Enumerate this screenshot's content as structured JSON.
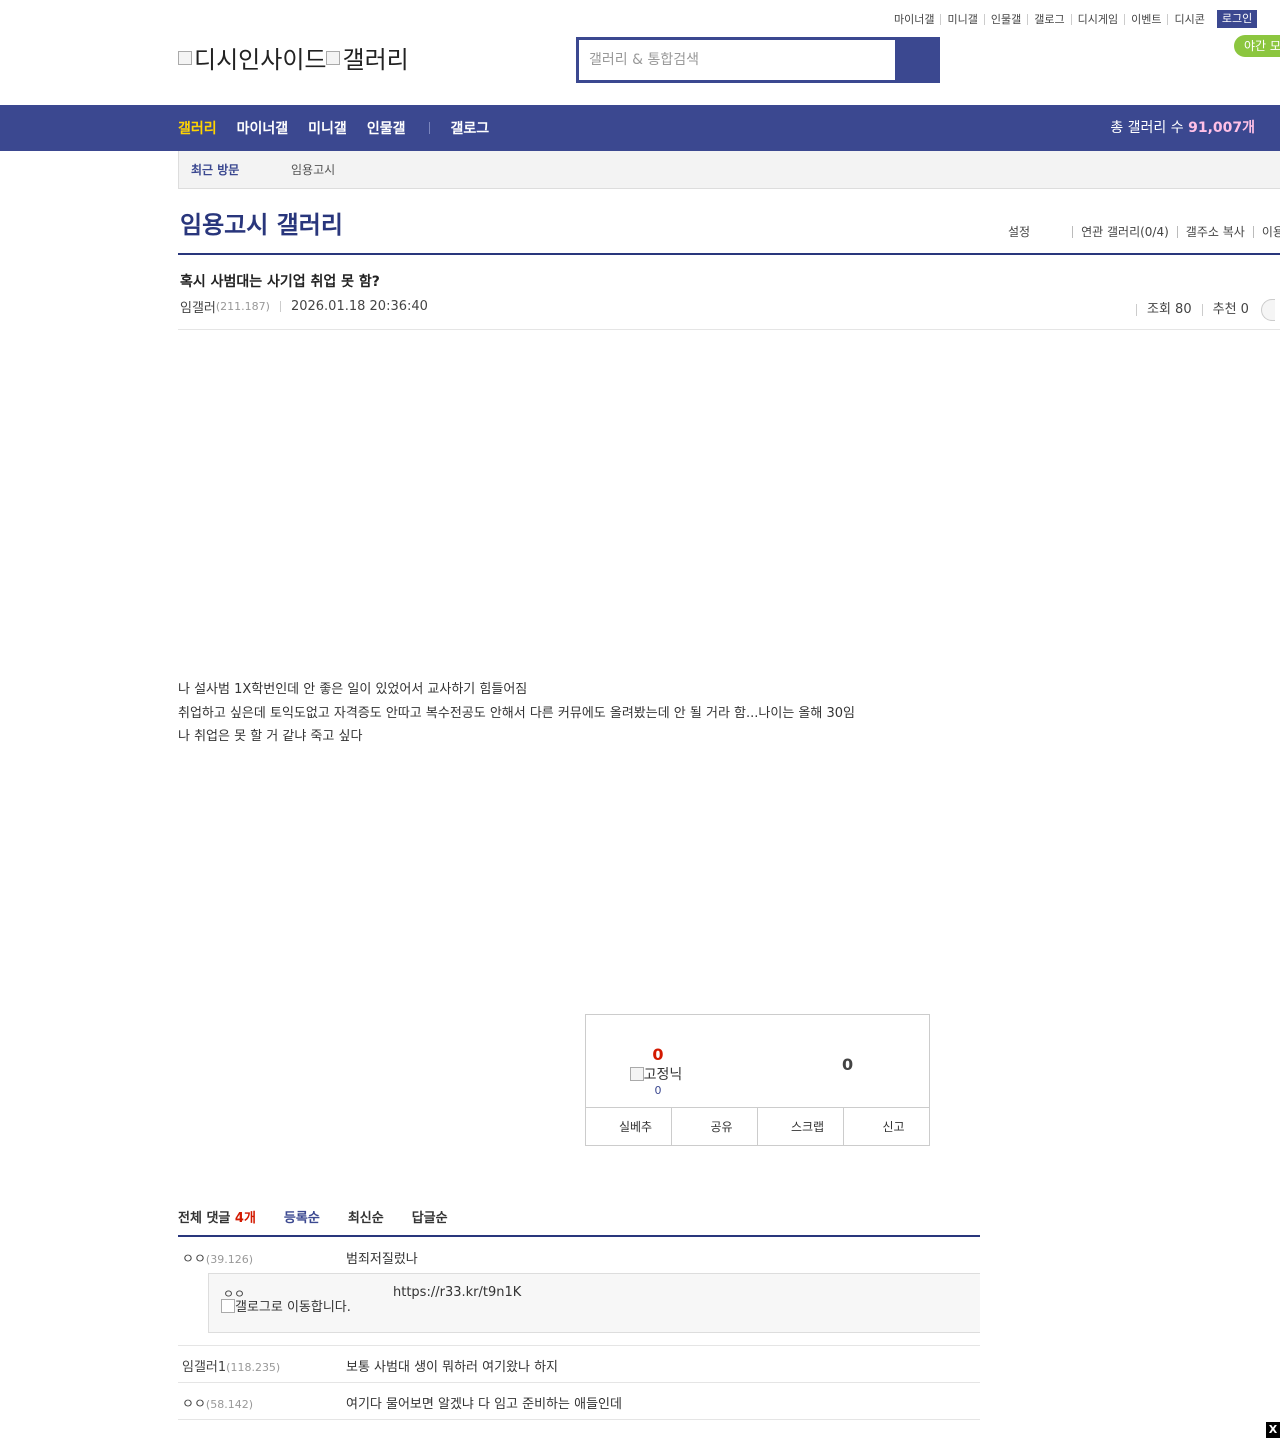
{
  "top_util": {
    "links": [
      "마이너갤",
      "미니갤",
      "인물갤",
      "갤로그",
      "디시게임",
      "이벤트",
      "디시콘"
    ],
    "login": "로그인",
    "night_mode": "야간 모드"
  },
  "logo": {
    "site_alt": "디시인사이드",
    "gallery_alt": "갤러리"
  },
  "search": {
    "placeholder": "갤러리 & 통합검색"
  },
  "gnb": {
    "menu": [
      "갤러리",
      "마이너갤",
      "미니갤",
      "인물갤"
    ],
    "gallog": "갤로그",
    "count_label": "총 갤러리 수",
    "count_value": "91,007개"
  },
  "recent": {
    "label": "최근 방문",
    "items": [
      "임용고시"
    ]
  },
  "gallery": {
    "title": "임용고시 갤러리",
    "tools": [
      "설정",
      "연관 갤러리(0/4)",
      "갤주소 복사",
      "이용"
    ]
  },
  "post": {
    "title": "혹시 사범대는 사기업 취업 못 함?",
    "author": "임갤러",
    "author_ip": "(211.187)",
    "date": "2026.01.18 20:36:40",
    "views": "조회 80",
    "recommends": "추천 0",
    "body": [
      "나 설사범 1X학번인데 안 좋은 일이 있었어서 교사하기 힘들어짐",
      "취업하고 싶은데 토익도없고 자격증도 안따고 복수전공도 안해서 다른 커뮤에도 올려봤는데 안 될 거라 함...나이는 올해 30임",
      "나 취업은 못 할 거 같냐 죽고 싶다"
    ]
  },
  "recommend": {
    "up": "0",
    "fixed_nick_alt": "고정닉",
    "fixed_count": "0",
    "down": "0",
    "buttons": [
      "실베추",
      "공유",
      "스크랩",
      "신고"
    ]
  },
  "comments": {
    "label": "전체 댓글",
    "count": "4",
    "unit": "개",
    "sorts": [
      "등록순",
      "최신순",
      "답글순"
    ],
    "list": [
      {
        "nick": "ㅇㅇ",
        "ip": "(39.126)",
        "text": "범죄저질렀나"
      },
      {
        "nick": "임갤러1",
        "ip": "(118.235)",
        "text": "보통 사범대 생이 뭐하러 여기왔나 하지"
      },
      {
        "nick": "ㅇㅇ",
        "ip": "(58.142)",
        "text": "여기다 물어보면 알겠냐 다 임고 준비하는 애들인데"
      }
    ],
    "reply": {
      "nick": "ㅇㅇ",
      "img_alt": "갤로그로 이동합니다.",
      "text": "https://r33.kr/t9n1K"
    }
  },
  "close": "X"
}
